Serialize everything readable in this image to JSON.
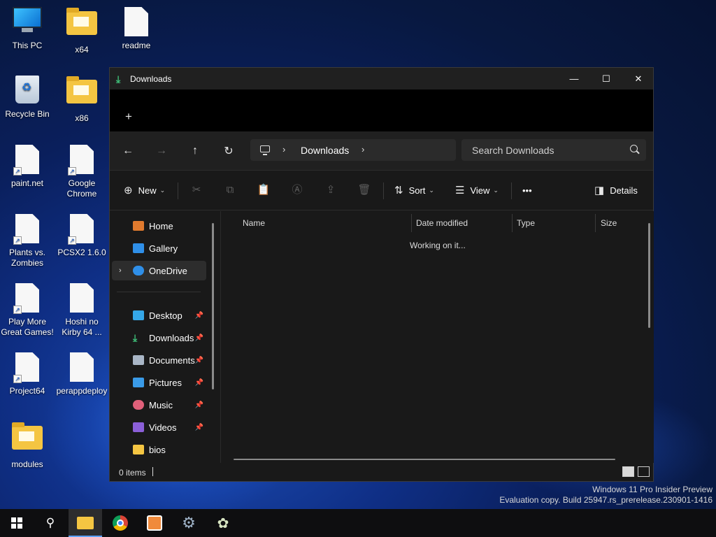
{
  "desktop": {
    "icons": [
      {
        "label": "This PC"
      },
      {
        "label": "x64"
      },
      {
        "label": "readme"
      },
      {
        "label": "Recycle Bin"
      },
      {
        "label": "x86"
      },
      {
        "label": "paint.net"
      },
      {
        "label": "Google Chrome"
      },
      {
        "label": "Plants vs. Zombies"
      },
      {
        "label": "PCSX2 1.6.0"
      },
      {
        "label": "Play More Great Games!"
      },
      {
        "label": "Hoshi no Kirby 64 ..."
      },
      {
        "label": "Project64"
      },
      {
        "label": "perappdeploy"
      },
      {
        "label": "modules"
      }
    ],
    "watermark_line1": "Windows 11 Pro Insider Preview",
    "watermark_line2": "Evaluation copy. Build 25947.rs_prerelease.230901-1416"
  },
  "window": {
    "title": "Downloads",
    "new_tab_symbol": "+",
    "breadcrumb_current": "Downloads",
    "search_placeholder": "Search Downloads",
    "commands": {
      "new_label": "New",
      "sort_label": "Sort",
      "view_label": "View",
      "more_label": "•••",
      "details_label": "Details"
    },
    "sidebar": {
      "items": [
        {
          "label": "Home",
          "color": "#e07a2e"
        },
        {
          "label": "Gallery",
          "color": "#2f8fe8"
        },
        {
          "label": "OneDrive",
          "color": "#2f8fe8"
        },
        {
          "label": "Desktop",
          "color": "#35a7e8"
        },
        {
          "label": "Downloads",
          "color": "#3fc27a"
        },
        {
          "label": "Documents",
          "color": "#a9b6c6"
        },
        {
          "label": "Pictures",
          "color": "#3a9be8"
        },
        {
          "label": "Music",
          "color": "#e0607a"
        },
        {
          "label": "Videos",
          "color": "#8b5fd8"
        },
        {
          "label": "bios",
          "color": "#f4c542"
        }
      ]
    },
    "columns": {
      "name": "Name",
      "date_modified": "Date modified",
      "type": "Type",
      "size": "Size"
    },
    "loading_text": "Working on it...",
    "status_count": "0 items"
  },
  "colors": {
    "accent": "#5ea2ff",
    "window_bg": "#191919",
    "titlebar_bg": "#202020"
  }
}
